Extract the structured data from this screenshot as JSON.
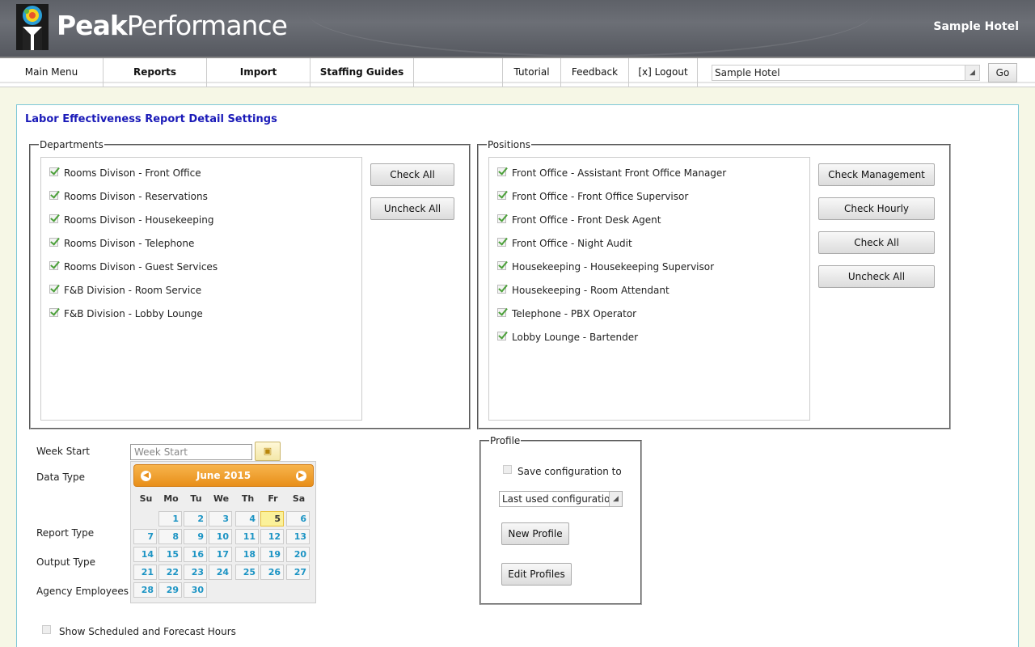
{
  "header": {
    "brand_bold": "Peak",
    "brand_rest": "Performance",
    "hotel_name": "Sample Hotel"
  },
  "nav": {
    "items": [
      "Main Menu",
      "Reports",
      "Import",
      "Staffing Guides",
      "Tutorial",
      "Feedback",
      "[x] Logout"
    ],
    "hotel_select": "Sample Hotel",
    "go": "Go"
  },
  "page": {
    "title": "Labor Effectiveness Report Detail Settings"
  },
  "departments": {
    "legend": "Departments",
    "items": [
      "Rooms Divison - Front Office",
      "Rooms Divison - Reservations",
      "Rooms Divison - Housekeeping",
      "Rooms Divison - Telephone",
      "Rooms Divison - Guest Services",
      "F&B Division - Room Service",
      "F&B Division - Lobby Lounge"
    ],
    "check_all": "Check All",
    "uncheck_all": "Uncheck All"
  },
  "positions": {
    "legend": "Positions",
    "items": [
      "Front Office - Assistant Front Office Manager",
      "Front Office - Front Office Supervisor",
      "Front Office - Front Desk Agent",
      "Front Office - Night Audit",
      "Housekeeping - Housekeeping Supervisor",
      "Housekeeping - Room Attendant",
      "Telephone - PBX Operator",
      "Lobby Lounge - Bartender"
    ],
    "check_management": "Check Management",
    "check_hourly": "Check Hourly",
    "check_all": "Check All",
    "uncheck_all": "Uncheck All"
  },
  "form": {
    "week_start_label": "Week Start",
    "week_start_placeholder": "Week Start",
    "data_type_label": "Data Type",
    "report_type_label": "Report Type",
    "output_type_label": "Output Type",
    "agency_label": "Agency Employees",
    "show_hours_label": "Show Scheduled and Forecast Hours"
  },
  "datepicker": {
    "title": "June 2015",
    "dow": [
      "Su",
      "Mo",
      "Tu",
      "We",
      "Th",
      "Fr",
      "Sa"
    ],
    "first_weekday": 1,
    "days_in_month": 30,
    "today": 5
  },
  "profile": {
    "legend": "Profile",
    "save_label": "Save configuration to",
    "select_value": "Last used configuration",
    "new_profile": "New Profile",
    "edit_profiles": "Edit Profiles"
  },
  "colors": {
    "accent_orange": "#e88f1a",
    "title_blue": "#1a1ab8",
    "panel_border": "#7ec8d8",
    "day_link": "#1c94c4"
  }
}
